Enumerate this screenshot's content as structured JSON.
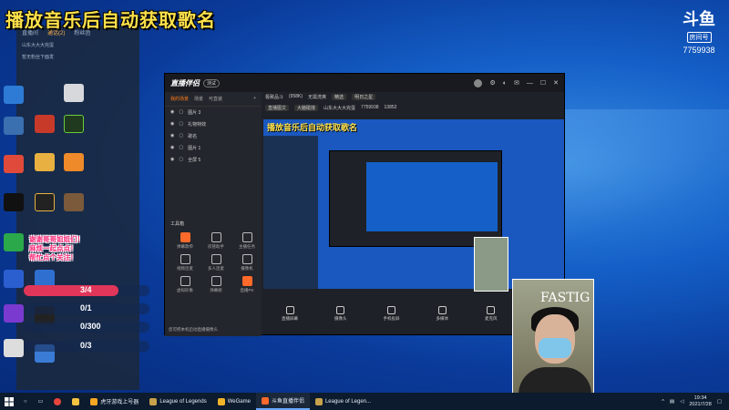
{
  "banner": "播放音乐后自动获取歌名",
  "douyu": {
    "mark": "斗鱼",
    "tag": "房间号",
    "room": "7759938"
  },
  "sidepanel": {
    "tabs": [
      "直播间",
      "通话(2)",
      "粉丝团"
    ],
    "lines": [
      "山东大大大完蛋",
      "暂无粉丝下面发"
    ]
  },
  "app": {
    "logo": "直播伴侣",
    "version": "测试",
    "tabs": [
      "我的场景",
      "场景",
      "可直装"
    ],
    "sources": [
      "图片 3",
      "礼物特效",
      "歌名",
      "图片 1",
      "全屏 5"
    ],
    "tools_title": "工具箱",
    "tools": [
      "弹幕歌单",
      "房管助手",
      "主播任务",
      "视频连麦",
      "多人连麦",
      "摄像机",
      "虚拟形象",
      "弹幕姬",
      "直播PK"
    ],
    "notice": "您可把本机启动直播摄像头",
    "info_row1": [
      "极致品斗",
      "(958K)",
      "无需洗爽",
      "精选",
      "明日之星"
    ],
    "info_row2": [
      "直播图文",
      "大脑碰撞",
      "山东大大大完蛋",
      "7759938",
      "13852"
    ],
    "preview_banner": "播放音乐后自动获取歌名",
    "bottom_buttons": [
      "直播屏幕",
      "摄像头",
      "手机投屏",
      "多媒体",
      "麦克风",
      "扬声器"
    ]
  },
  "overlay": {
    "pink_lines": [
      "谢谢哥哥姐姐们！",
      "麻烦一起点点！",
      "帮忙点个关注！"
    ],
    "progress": [
      {
        "text": "3/4",
        "fill": 0.75,
        "color": "#e0365a"
      },
      {
        "text": "0/1",
        "fill": 0.0,
        "color": "#3a8fe0"
      },
      {
        "text": "0/300",
        "fill": 0.0,
        "color": "#3a8fe0"
      },
      {
        "text": "0/3",
        "fill": 0.0,
        "color": "#3a8fe0"
      }
    ]
  },
  "cam": {
    "brand": "FASTIG"
  },
  "taskbar": {
    "apps": [
      {
        "label": "虎牙游戏上号器",
        "color": "#f5a623"
      },
      {
        "label": "League of Legends",
        "color": "#c8a24a"
      },
      {
        "label": "WeGame",
        "color": "#f0b429"
      },
      {
        "label": "斗鱼直播伴侣",
        "color": "#ff6a2a"
      },
      {
        "label": "League of Legen...",
        "color": "#c8a24a"
      }
    ],
    "time": "19:34",
    "date": "2021/7/28"
  },
  "colors": {
    "banner": "#ffe14a",
    "accent": "#ff6a2a",
    "taskbar": "#0c1b2e"
  }
}
